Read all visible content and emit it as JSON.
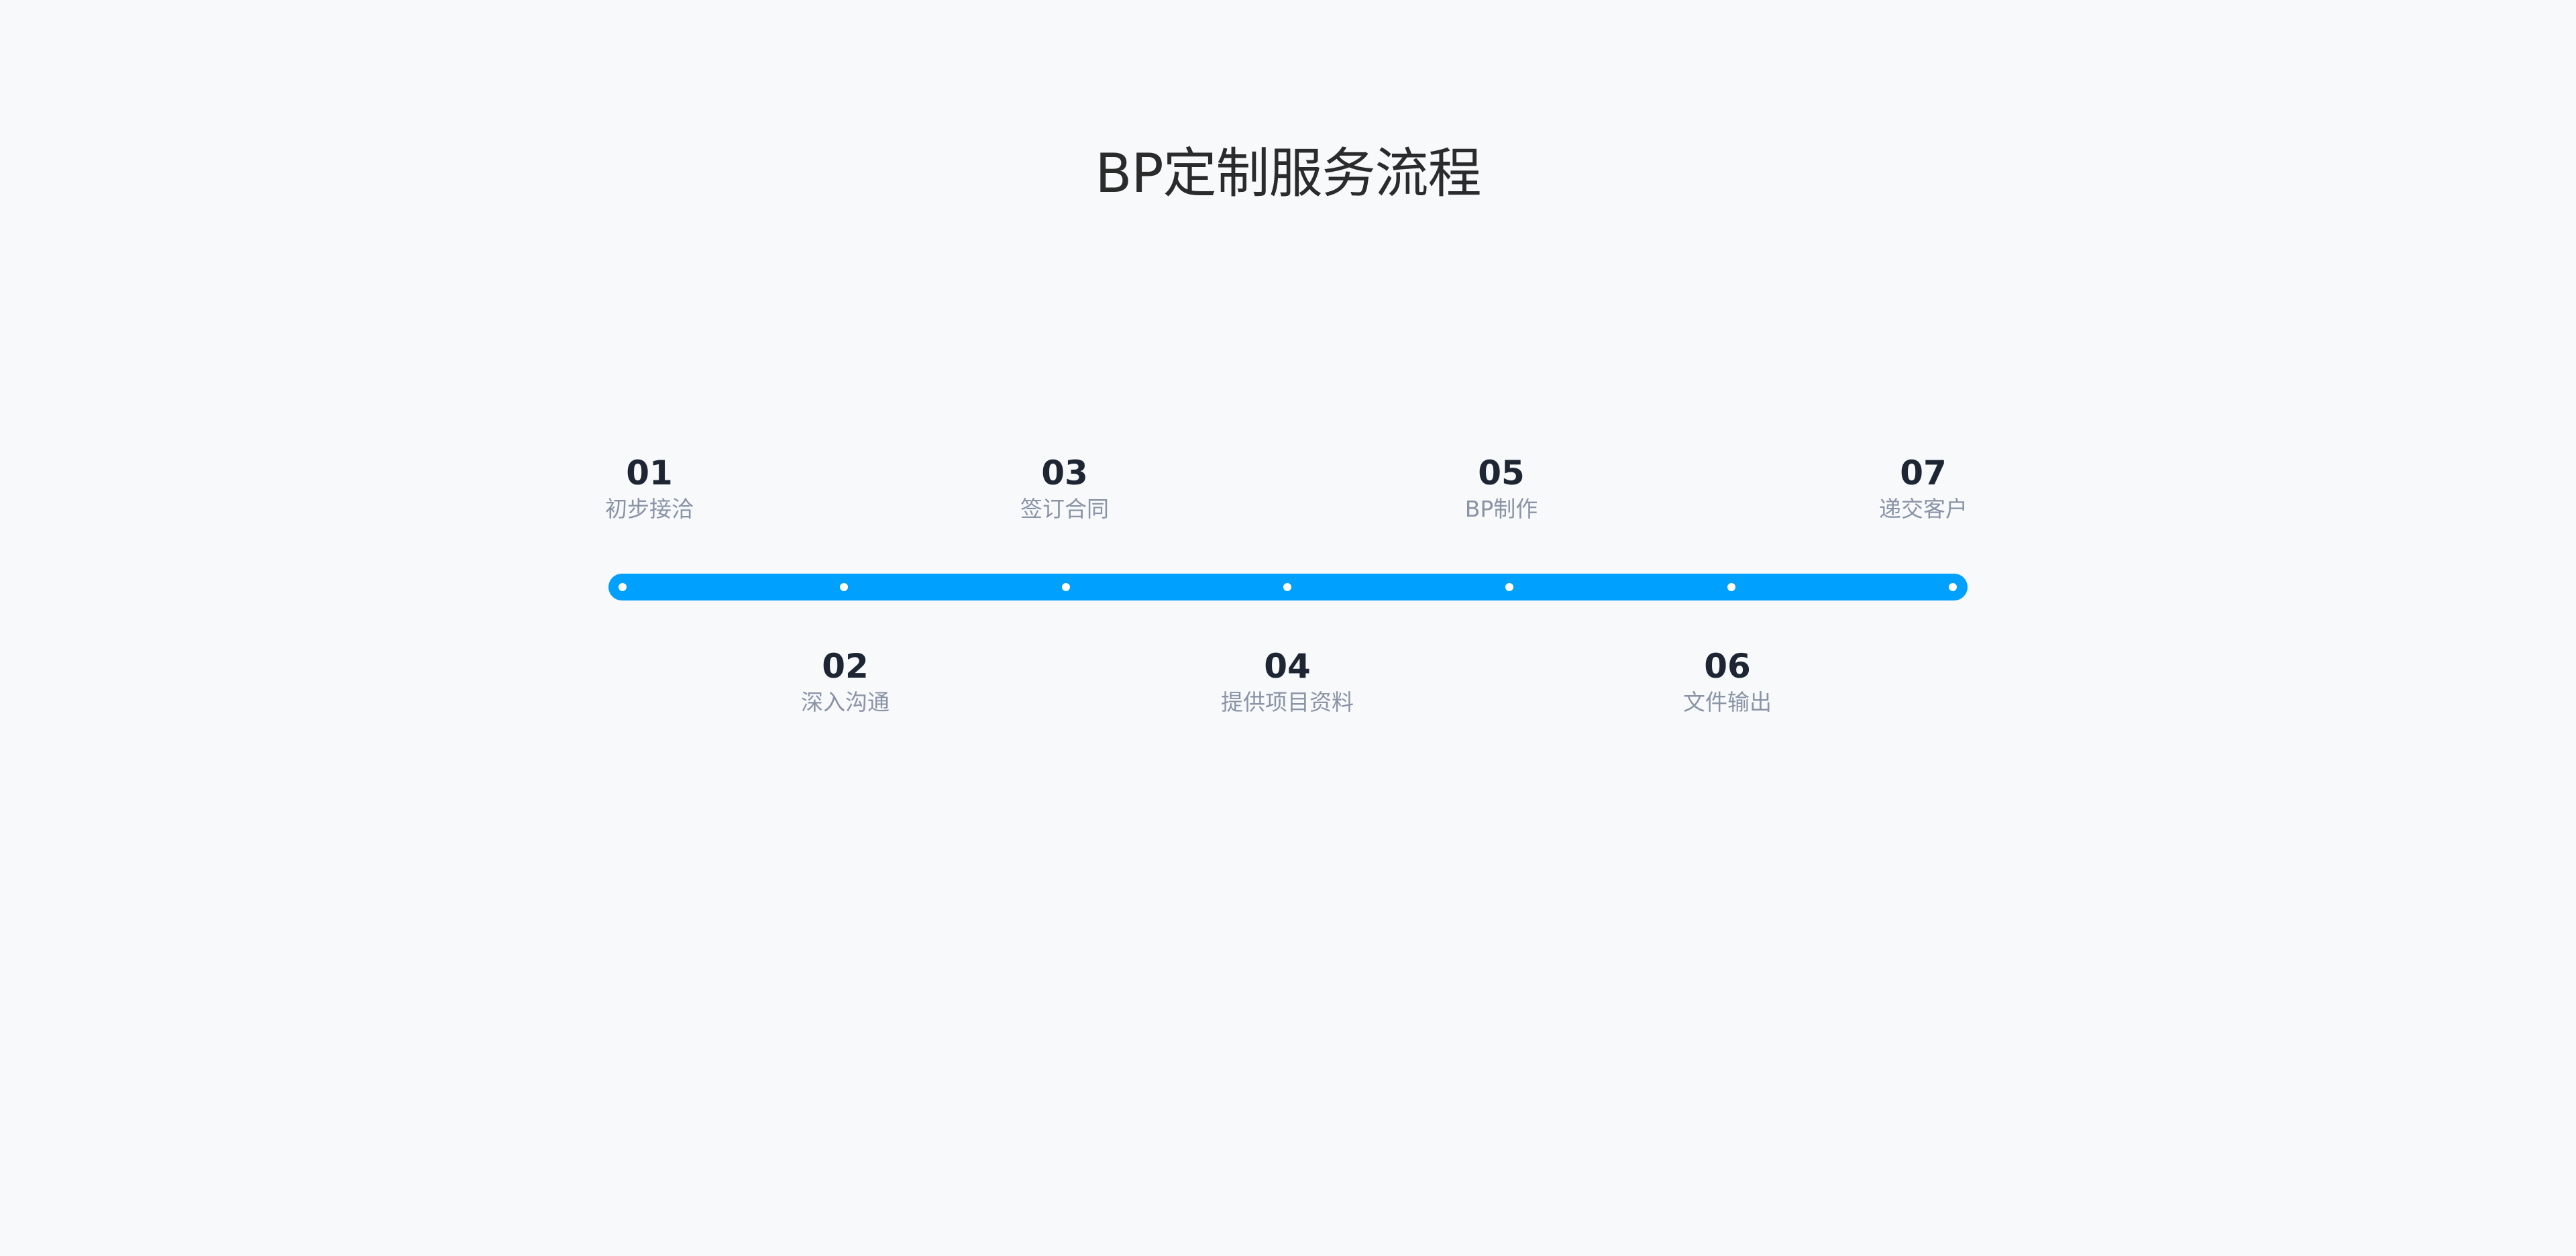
{
  "title": "BP定制服务流程",
  "accent_color": "#00a0ff",
  "steps": [
    {
      "number": "01",
      "label": "初步接洽"
    },
    {
      "number": "02",
      "label": "深入沟通"
    },
    {
      "number": "03",
      "label": "签订合同"
    },
    {
      "number": "04",
      "label": "提供项目资料"
    },
    {
      "number": "05",
      "label": "BP制作"
    },
    {
      "number": "06",
      "label": "文件输出"
    },
    {
      "number": "07",
      "label": "递交客户"
    }
  ]
}
